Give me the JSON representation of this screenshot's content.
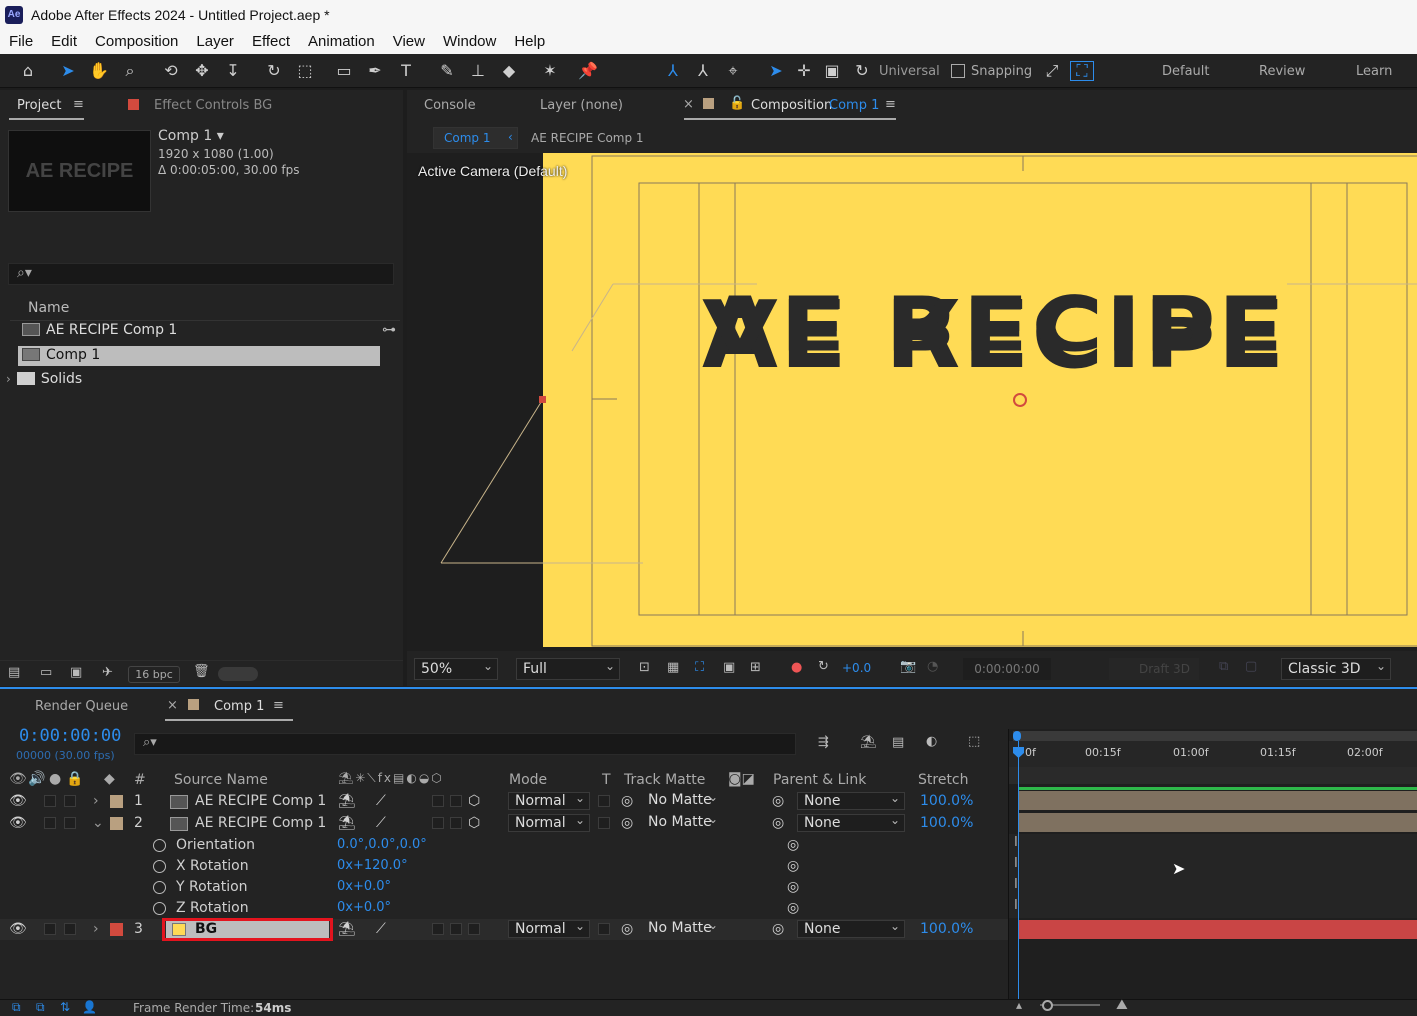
{
  "window": {
    "title": "Adobe After Effects 2024 - Untitled Project.aep *",
    "logo": "Ae"
  },
  "menu": [
    "File",
    "Edit",
    "Composition",
    "Layer",
    "Effect",
    "Animation",
    "View",
    "Window",
    "Help"
  ],
  "toolbar": {
    "axis_mode": "Universal",
    "snapping": "Snapping",
    "workspaces": [
      "Default",
      "Review",
      "Learn"
    ]
  },
  "project_panel": {
    "tab": "Project",
    "effect_controls_tab": "Effect Controls BG",
    "thumb_text": "AE RECIPE",
    "comp_name": "Comp 1",
    "comp_size": "1920 x 1080 (1.00)",
    "comp_duration": "Δ 0:00:05:00, 30.00 fps",
    "search_placeholder": "",
    "col_name": "Name",
    "items": [
      {
        "name": "AE RECIPE Comp 1",
        "icon": "composition-icon"
      },
      {
        "name": "Comp 1",
        "icon": "composition-icon",
        "selected": true
      },
      {
        "name": "Solids",
        "icon": "folder-icon"
      }
    ],
    "bpc": "16 bpc"
  },
  "viewer": {
    "tabs": [
      "Console",
      "Layer (none)",
      "Composition",
      "Comp 1"
    ],
    "breadcrumb": [
      "Comp 1",
      "AE RECIPE Comp 1"
    ],
    "camera_label": "Active Camera (Default)",
    "canvas_text": "AE RECIPE",
    "canvas_color": "#ffdb55",
    "zoom": "50%",
    "resolution": "Full",
    "exposure": "+0.0",
    "timecode": "0:00:00:00",
    "draft3d": "Draft 3D",
    "renderer": "Classic 3D"
  },
  "timeline": {
    "render_queue_tab": "Render Queue",
    "comp_tab": "Comp 1",
    "timecode": "0:00:00:00",
    "frame_info": "00000 (30.00 fps)",
    "search_placeholder": "",
    "columns": {
      "num": "#",
      "source": "Source Name",
      "mode": "Mode",
      "t": "T",
      "matte": "Track Matte",
      "parent": "Parent & Link",
      "stretch": "Stretch"
    },
    "ruler": [
      "0f",
      "00:15f",
      "01:00f",
      "01:15f",
      "02:00f"
    ],
    "layers": [
      {
        "num": "1",
        "name": "AE RECIPE Comp 1",
        "mode": "Normal",
        "matte": "No Matte",
        "parent": "None",
        "stretch": "100.0%",
        "label_color": "#b9a080"
      },
      {
        "num": "2",
        "name": "AE RECIPE Comp 1",
        "mode": "Normal",
        "matte": "No Matte",
        "parent": "None",
        "stretch": "100.0%",
        "label_color": "#b9a080"
      },
      {
        "num": "3",
        "name": "BG",
        "mode": "Normal",
        "matte": "No Matte",
        "parent": "None",
        "stretch": "100.0%",
        "label_color": "#d24a3e"
      }
    ],
    "properties": [
      {
        "name": "Orientation",
        "value": "0.0°,0.0°,0.0°"
      },
      {
        "name": "X Rotation",
        "value": "0x+120.0°"
      },
      {
        "name": "Y Rotation",
        "value": "0x+0.0°"
      },
      {
        "name": "Z Rotation",
        "value": "0x+0.0°"
      }
    ],
    "frame_render_label": "Frame Render Time:",
    "frame_render_value": "54ms"
  }
}
